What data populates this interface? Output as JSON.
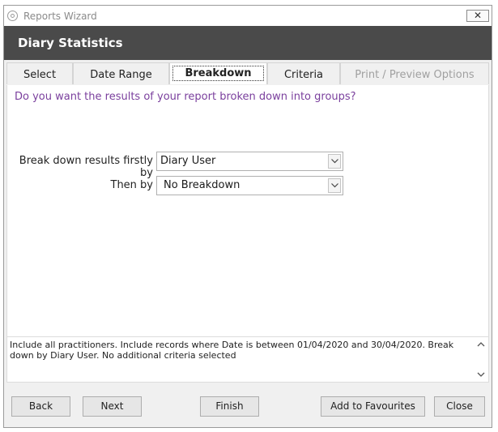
{
  "window": {
    "title": "Reports Wizard",
    "close_glyph": "✕"
  },
  "header": {
    "title": "Diary Statistics"
  },
  "tabs": [
    {
      "label": "Select"
    },
    {
      "label": "Date Range"
    },
    {
      "label": "Breakdown"
    },
    {
      "label": "Criteria"
    },
    {
      "label": "Print / Preview Options"
    }
  ],
  "main": {
    "question": "Do you want the results of your report broken down into groups?",
    "first_label": "Break down results firstly by",
    "first_value": "Diary User",
    "then_label": "Then by",
    "then_value": "No Breakdown"
  },
  "summary": {
    "text": "Include all practitioners. Include records where Date is between 01/04/2020 and 30/04/2020. Break down by Diary User. No additional criteria selected"
  },
  "footer": {
    "back_label": "Back",
    "next_label": "Next",
    "finish_label": "Finish",
    "favourites_label": "Add to Favourites",
    "close_label": "Close"
  },
  "colors": {
    "header_bg": "#4a4a4a",
    "question_text": "#7a3f9d"
  },
  "icons": {
    "app": "app-logo-icon",
    "close": "close-icon",
    "dropdown": "chevron-down-icon",
    "scroll_up": "chevron-up-icon",
    "scroll_down": "chevron-down-icon"
  }
}
